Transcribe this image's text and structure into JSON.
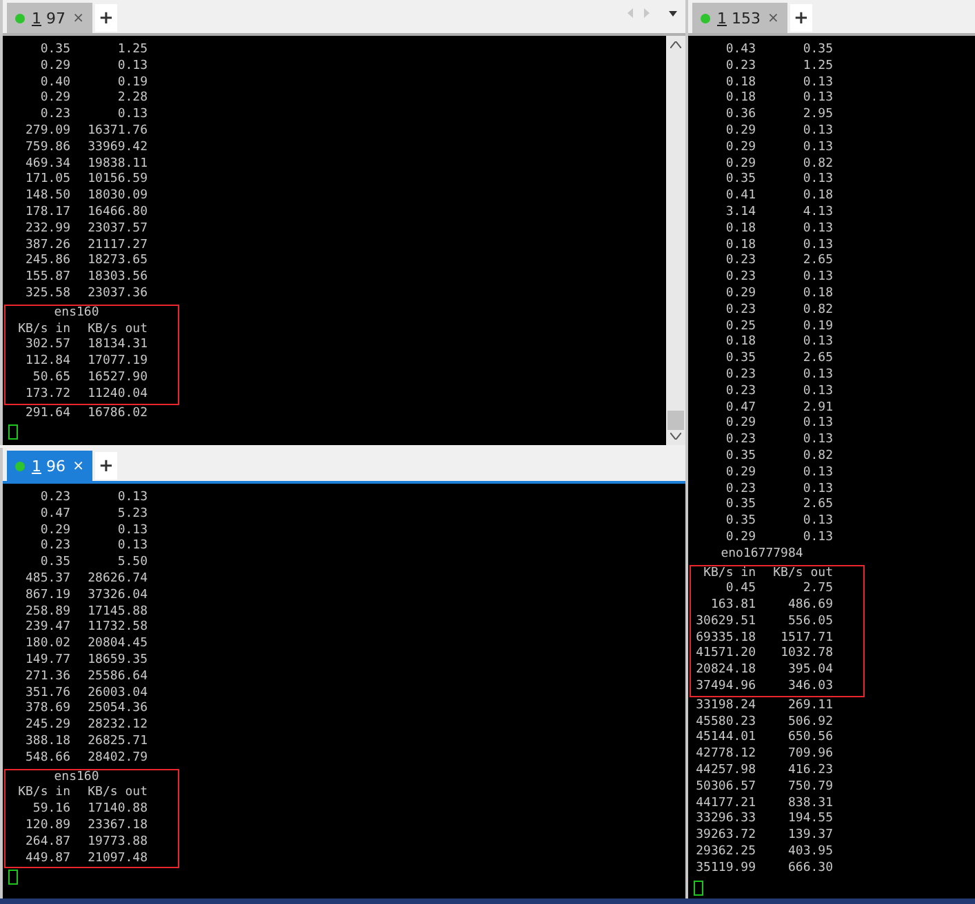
{
  "panes": [
    {
      "tab": {
        "hotkey": "1",
        "label": "97",
        "focused": false,
        "close": "×"
      },
      "new_tab": "+",
      "tab_nav": true,
      "scrollbar": true,
      "cursor": true,
      "blocks": [
        {
          "highlighted": false,
          "lines": [
            {
              "kind": "row",
              "in": "0.35",
              "out": "1.25"
            },
            {
              "kind": "row",
              "in": "0.29",
              "out": "0.13"
            },
            {
              "kind": "row",
              "in": "0.40",
              "out": "0.19"
            },
            {
              "kind": "row",
              "in": "0.29",
              "out": "2.28"
            },
            {
              "kind": "row",
              "in": "0.23",
              "out": "0.13"
            },
            {
              "kind": "row",
              "in": "279.09",
              "out": "16371.76"
            },
            {
              "kind": "row",
              "in": "759.86",
              "out": "33969.42"
            },
            {
              "kind": "row",
              "in": "469.34",
              "out": "19838.11"
            },
            {
              "kind": "row",
              "in": "171.05",
              "out": "10156.59"
            },
            {
              "kind": "row",
              "in": "148.50",
              "out": "18030.09"
            },
            {
              "kind": "row",
              "in": "178.17",
              "out": "16466.80"
            },
            {
              "kind": "row",
              "in": "232.99",
              "out": "23037.57"
            },
            {
              "kind": "row",
              "in": "387.26",
              "out": "21117.27"
            },
            {
              "kind": "row",
              "in": "245.86",
              "out": "18273.65"
            },
            {
              "kind": "row",
              "in": "155.87",
              "out": "18303.56"
            },
            {
              "kind": "row",
              "in": "325.58",
              "out": "23037.36"
            }
          ]
        },
        {
          "highlighted": true,
          "lines": [
            {
              "kind": "interface",
              "name": "ens160"
            },
            {
              "kind": "header",
              "in": "KB/s in",
              "out": "KB/s out"
            },
            {
              "kind": "row",
              "in": "302.57",
              "out": "18134.31"
            },
            {
              "kind": "row",
              "in": "112.84",
              "out": "17077.19"
            },
            {
              "kind": "row",
              "in": "50.65",
              "out": "16527.90"
            },
            {
              "kind": "row",
              "in": "173.72",
              "out": "11240.04"
            }
          ]
        },
        {
          "highlighted": false,
          "lines": [
            {
              "kind": "row",
              "in": "291.64",
              "out": "16786.02"
            }
          ]
        }
      ]
    },
    {
      "tab": {
        "hotkey": "1",
        "label": "96",
        "focused": true,
        "close": "×"
      },
      "new_tab": "+",
      "tab_nav": false,
      "scrollbar": false,
      "cursor": true,
      "blocks": [
        {
          "highlighted": false,
          "lines": [
            {
              "kind": "row",
              "in": "0.23",
              "out": "0.13"
            },
            {
              "kind": "row",
              "in": "0.47",
              "out": "5.23"
            },
            {
              "kind": "row",
              "in": "0.29",
              "out": "0.13"
            },
            {
              "kind": "row",
              "in": "0.23",
              "out": "0.13"
            },
            {
              "kind": "row",
              "in": "0.35",
              "out": "5.50"
            },
            {
              "kind": "row",
              "in": "485.37",
              "out": "28626.74"
            },
            {
              "kind": "row",
              "in": "867.19",
              "out": "37326.04"
            },
            {
              "kind": "row",
              "in": "258.89",
              "out": "17145.88"
            },
            {
              "kind": "row",
              "in": "239.47",
              "out": "11732.58"
            },
            {
              "kind": "row",
              "in": "180.02",
              "out": "20804.45"
            },
            {
              "kind": "row",
              "in": "149.77",
              "out": "18659.35"
            },
            {
              "kind": "row",
              "in": "271.36",
              "out": "25586.64"
            },
            {
              "kind": "row",
              "in": "351.76",
              "out": "26003.04"
            },
            {
              "kind": "row",
              "in": "378.69",
              "out": "25054.36"
            },
            {
              "kind": "row",
              "in": "245.29",
              "out": "28232.12"
            },
            {
              "kind": "row",
              "in": "388.18",
              "out": "26825.71"
            },
            {
              "kind": "row",
              "in": "548.66",
              "out": "28402.79"
            }
          ]
        },
        {
          "highlighted": true,
          "lines": [
            {
              "kind": "interface",
              "name": "ens160"
            },
            {
              "kind": "header",
              "in": "KB/s in",
              "out": "KB/s out"
            },
            {
              "kind": "row",
              "in": "59.16",
              "out": "17140.88"
            },
            {
              "kind": "row",
              "in": "120.89",
              "out": "23367.18"
            },
            {
              "kind": "row",
              "in": "264.87",
              "out": "19773.88"
            },
            {
              "kind": "row",
              "in": "449.87",
              "out": "21097.48"
            }
          ]
        }
      ]
    },
    {
      "tab": {
        "hotkey": "1",
        "label": "153",
        "focused": false,
        "close": "×"
      },
      "new_tab": "+",
      "tab_nav": false,
      "scrollbar": false,
      "cursor": true,
      "blocks": [
        {
          "highlighted": false,
          "lines": [
            {
              "kind": "row",
              "in": "0.43",
              "out": "0.35"
            },
            {
              "kind": "row",
              "in": "0.23",
              "out": "1.25"
            },
            {
              "kind": "row",
              "in": "0.18",
              "out": "0.13"
            },
            {
              "kind": "row",
              "in": "0.18",
              "out": "0.13"
            },
            {
              "kind": "row",
              "in": "0.36",
              "out": "2.95"
            },
            {
              "kind": "row",
              "in": "0.29",
              "out": "0.13"
            },
            {
              "kind": "row",
              "in": "0.29",
              "out": "0.13"
            },
            {
              "kind": "row",
              "in": "0.29",
              "out": "0.82"
            },
            {
              "kind": "row",
              "in": "0.35",
              "out": "0.13"
            },
            {
              "kind": "row",
              "in": "0.41",
              "out": "0.18"
            },
            {
              "kind": "row",
              "in": "3.14",
              "out": "4.13"
            },
            {
              "kind": "row",
              "in": "0.18",
              "out": "0.13"
            },
            {
              "kind": "row",
              "in": "0.18",
              "out": "0.13"
            },
            {
              "kind": "row",
              "in": "0.23",
              "out": "2.65"
            },
            {
              "kind": "row",
              "in": "0.23",
              "out": "0.13"
            },
            {
              "kind": "row",
              "in": "0.29",
              "out": "0.18"
            },
            {
              "kind": "row",
              "in": "0.23",
              "out": "0.82"
            },
            {
              "kind": "row",
              "in": "0.25",
              "out": "0.19"
            },
            {
              "kind": "row",
              "in": "0.18",
              "out": "0.13"
            },
            {
              "kind": "row",
              "in": "0.35",
              "out": "2.65"
            },
            {
              "kind": "row",
              "in": "0.23",
              "out": "0.13"
            },
            {
              "kind": "row",
              "in": "0.23",
              "out": "0.13"
            },
            {
              "kind": "row",
              "in": "0.47",
              "out": "2.91"
            },
            {
              "kind": "row",
              "in": "0.29",
              "out": "0.13"
            },
            {
              "kind": "row",
              "in": "0.23",
              "out": "0.13"
            },
            {
              "kind": "row",
              "in": "0.35",
              "out": "0.82"
            },
            {
              "kind": "row",
              "in": "0.29",
              "out": "0.13"
            },
            {
              "kind": "row",
              "in": "0.23",
              "out": "0.13"
            },
            {
              "kind": "row",
              "in": "0.35",
              "out": "2.65"
            },
            {
              "kind": "row",
              "in": "0.35",
              "out": "0.13"
            },
            {
              "kind": "row",
              "in": "0.29",
              "out": "0.13"
            },
            {
              "kind": "interface",
              "name": "eno16777984"
            }
          ]
        },
        {
          "highlighted": true,
          "lines": [
            {
              "kind": "header",
              "in": "KB/s in",
              "out": "KB/s out"
            },
            {
              "kind": "row",
              "in": "0.45",
              "out": "2.75"
            },
            {
              "kind": "row",
              "in": "163.81",
              "out": "486.69"
            },
            {
              "kind": "row",
              "in": "30629.51",
              "out": "556.05"
            },
            {
              "kind": "row",
              "in": "69335.18",
              "out": "1517.71"
            },
            {
              "kind": "row",
              "in": "41571.20",
              "out": "1032.78"
            },
            {
              "kind": "row",
              "in": "20824.18",
              "out": "395.04"
            },
            {
              "kind": "row",
              "in": "37494.96",
              "out": "346.03"
            }
          ]
        },
        {
          "highlighted": false,
          "lines": [
            {
              "kind": "row",
              "in": "33198.24",
              "out": "269.11"
            },
            {
              "kind": "row",
              "in": "45580.23",
              "out": "506.92"
            },
            {
              "kind": "row",
              "in": "45144.01",
              "out": "650.56"
            },
            {
              "kind": "row",
              "in": "42778.12",
              "out": "709.96"
            },
            {
              "kind": "row",
              "in": "44257.98",
              "out": "416.23"
            },
            {
              "kind": "row",
              "in": "50306.57",
              "out": "750.79"
            },
            {
              "kind": "row",
              "in": "44177.21",
              "out": "838.31"
            },
            {
              "kind": "row",
              "in": "33296.33",
              "out": "194.55"
            },
            {
              "kind": "row",
              "in": "39263.72",
              "out": "139.37"
            },
            {
              "kind": "row",
              "in": "29362.25",
              "out": "403.95"
            },
            {
              "kind": "row",
              "in": "35119.99",
              "out": "666.30"
            }
          ]
        }
      ]
    }
  ]
}
